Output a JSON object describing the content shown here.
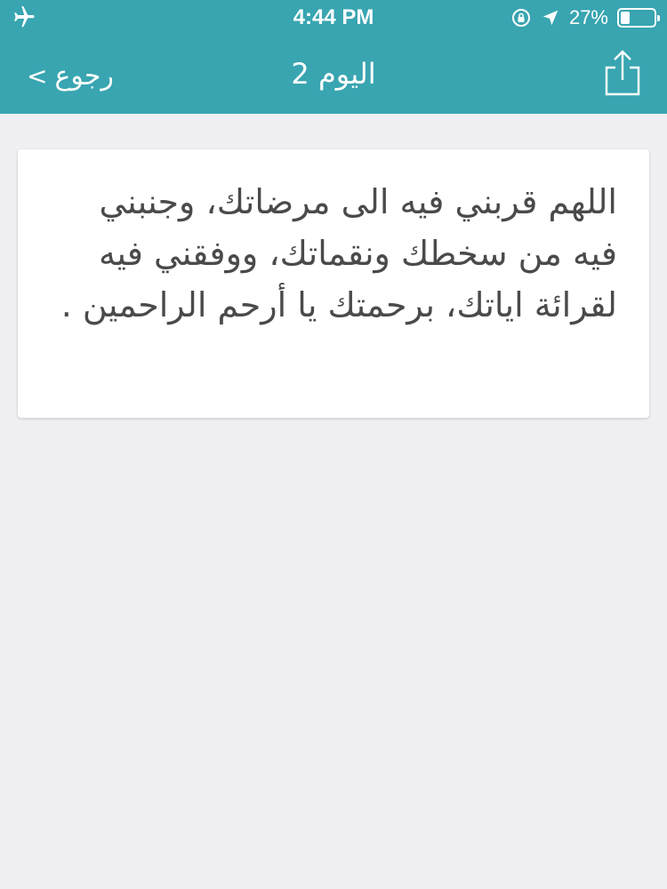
{
  "status_bar": {
    "time": "4:44 PM",
    "battery_percent": "27%",
    "battery_level": 0.27,
    "icons": [
      "airplane-icon",
      "orientation-lock-icon",
      "location-arrow-icon",
      "battery-icon"
    ]
  },
  "nav_bar": {
    "back_label": "رجوع",
    "back_chevron": ">",
    "title": "اليوم 2",
    "share_icon": "share-icon"
  },
  "content": {
    "prayer_text": "اللهم قربني فيه الى مرضاتك، وجنبني فيه من سخطك ونقماتك، ووفقني فيه لقرائة اياتك، برحمتك يا أرحم الراحمين ."
  },
  "colors": {
    "header": "#38a5b1",
    "background": "#efeff4",
    "card": "#ffffff",
    "text": "#4a4a4a"
  }
}
